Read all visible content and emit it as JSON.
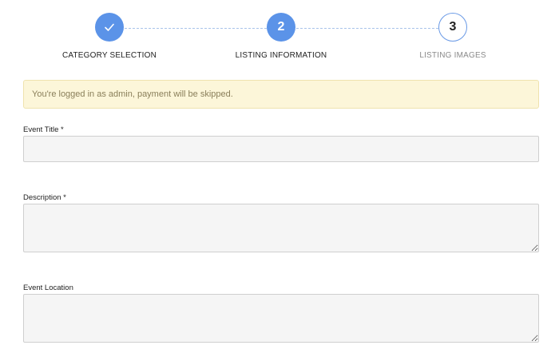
{
  "stepper": {
    "steps": [
      {
        "number": "",
        "label": "CATEGORY SELECTION",
        "state": "done",
        "icon": "check-icon"
      },
      {
        "number": "2",
        "label": "LISTING INFORMATION",
        "state": "active"
      },
      {
        "number": "3",
        "label": "LISTING IMAGES",
        "state": "todo"
      }
    ],
    "colors": {
      "active": "#5b93e8",
      "connector": "#a9c3ea"
    }
  },
  "alert": {
    "text": "You're logged in as admin, payment will be skipped.",
    "background": "#fcf6d9"
  },
  "form": {
    "event_title": {
      "label": "Event Title *",
      "value": "",
      "placeholder": ""
    },
    "description": {
      "label": "Description *",
      "value": "",
      "placeholder": ""
    },
    "event_location": {
      "label": "Event Location",
      "value": "",
      "placeholder": ""
    }
  }
}
